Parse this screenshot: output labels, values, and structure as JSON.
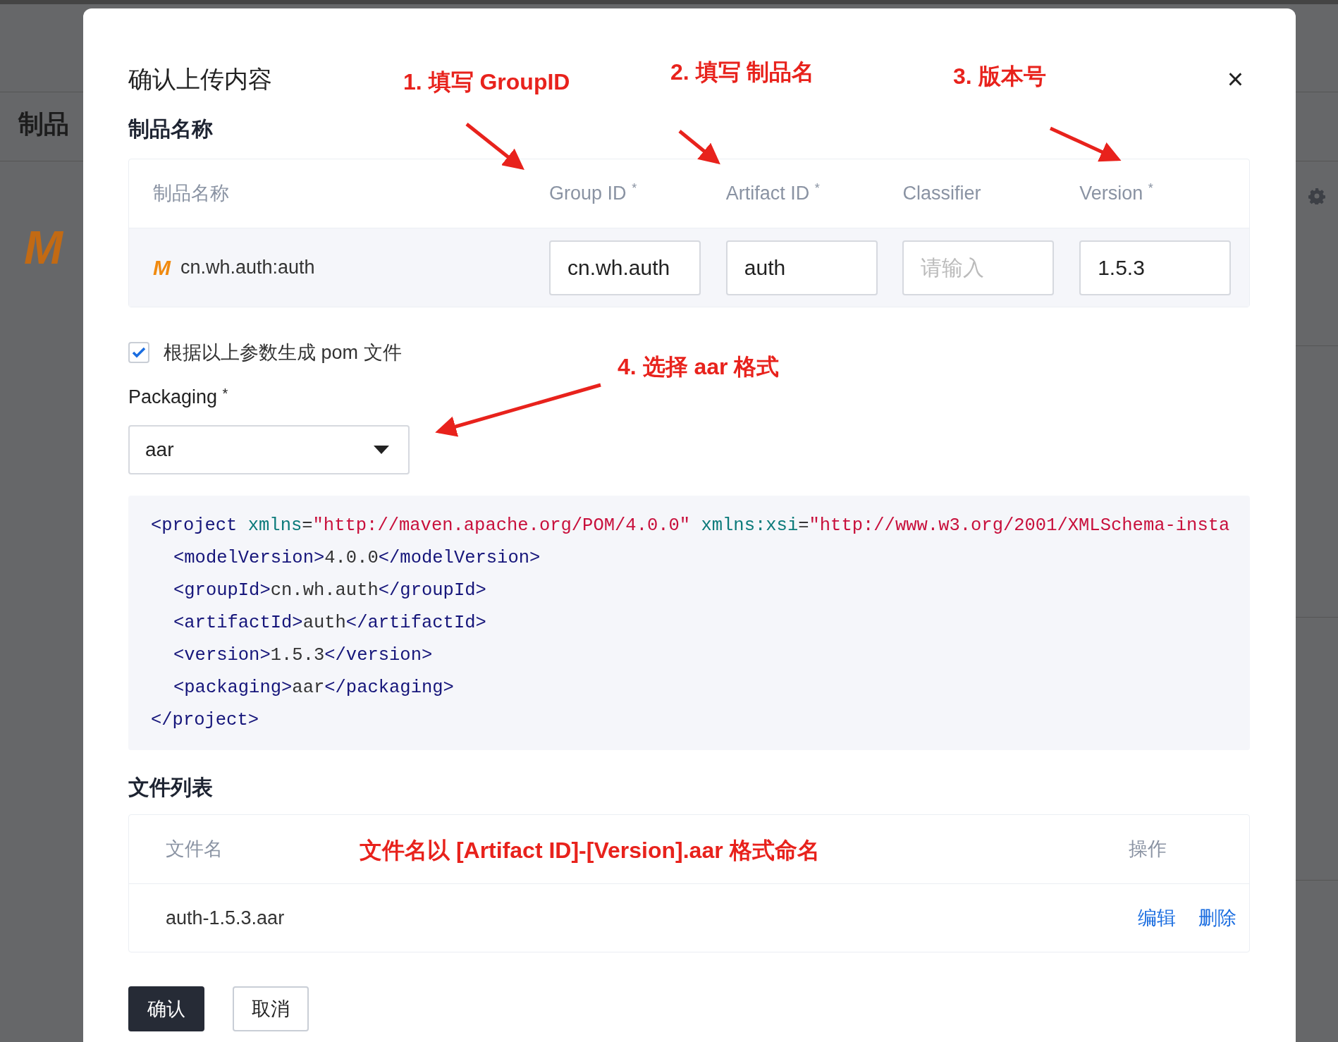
{
  "background": {
    "heading": "制品",
    "logo": "M"
  },
  "dialog": {
    "title": "确认上传内容",
    "close": "×",
    "artifact_section": "制品名称",
    "artifact_table": {
      "columns": [
        {
          "label": "制品名称"
        },
        {
          "label": "Group ID",
          "mark": "*"
        },
        {
          "label": "Artifact ID",
          "mark": "*"
        },
        {
          "label": "Classifier"
        },
        {
          "label": "Version",
          "mark": "*"
        }
      ],
      "row": {
        "logo": "M",
        "name": "cn.wh.auth:auth",
        "fields": [
          {
            "value": "cn.wh.auth"
          },
          {
            "value": "auth"
          },
          {
            "placeholder": "请输入"
          },
          {
            "value": "1.5.3"
          }
        ]
      }
    },
    "generate_pom": {
      "label": "根据以上参数生成 pom 文件",
      "checked": true
    },
    "packaging": {
      "label": "Packaging",
      "mark": "*",
      "value": "aar"
    },
    "pom_code": [
      {
        "indent": false,
        "tokens": [
          {
            "kind": "tag",
            "text": "<project"
          },
          {
            "kind": "attr",
            "text": " xmlns"
          },
          {
            "kind": "text",
            "text": "="
          },
          {
            "kind": "string",
            "text": "\"http://maven.apache.org/POM/4.0.0\""
          },
          {
            "kind": "attr",
            "text": " xmlns:xsi"
          },
          {
            "kind": "text",
            "text": "="
          },
          {
            "kind": "string",
            "text": "\"http://www.w3.org/2001/XMLSchema-insta"
          }
        ]
      },
      {
        "indent": true,
        "tokens": [
          {
            "kind": "tag",
            "text": "<modelVersion>"
          },
          {
            "kind": "text",
            "text": "4.0.0"
          },
          {
            "kind": "tag",
            "text": "</modelVersion>"
          }
        ]
      },
      {
        "indent": true,
        "tokens": [
          {
            "kind": "tag",
            "text": "<groupId>"
          },
          {
            "kind": "text",
            "text": "cn.wh.auth"
          },
          {
            "kind": "tag",
            "text": "</groupId>"
          }
        ]
      },
      {
        "indent": true,
        "tokens": [
          {
            "kind": "tag",
            "text": "<artifactId>"
          },
          {
            "kind": "text",
            "text": "auth"
          },
          {
            "kind": "tag",
            "text": "</artifactId>"
          }
        ]
      },
      {
        "indent": true,
        "tokens": [
          {
            "kind": "tag",
            "text": "<version>"
          },
          {
            "kind": "text",
            "text": "1.5.3"
          },
          {
            "kind": "tag",
            "text": "</version>"
          }
        ]
      },
      {
        "indent": true,
        "tokens": [
          {
            "kind": "tag",
            "text": "<packaging>"
          },
          {
            "kind": "text",
            "text": "aar"
          },
          {
            "kind": "tag",
            "text": "</packaging>"
          }
        ]
      },
      {
        "indent": false,
        "tokens": [
          {
            "kind": "tag",
            "text": "</project>"
          }
        ]
      }
    ],
    "files_section": "文件列表",
    "file_table": {
      "columns": [
        "文件名",
        "操作"
      ],
      "rows": [
        {
          "name": "auth-1.5.3.aar",
          "actions": [
            "编辑",
            "删除"
          ]
        }
      ]
    },
    "buttons": [
      {
        "label": "确认",
        "kind": "primary"
      },
      {
        "label": "取消",
        "kind": "default"
      }
    ]
  },
  "annotations": [
    {
      "text": "1. 填写 GroupID"
    },
    {
      "text": "2. 填写 制品名"
    },
    {
      "text": "3. 版本号"
    },
    {
      "text": "4. 选择 aar 格式"
    },
    {
      "text": "文件名以 [Artifact ID]-[Version].aar 格式命名"
    }
  ]
}
